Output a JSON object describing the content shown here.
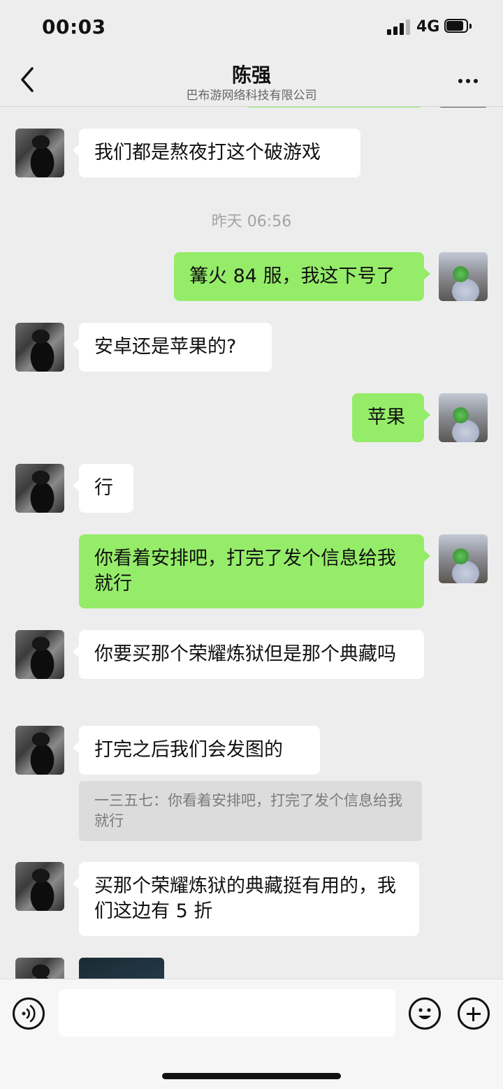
{
  "status_bar": {
    "time": "00:03",
    "network": "4G"
  },
  "header": {
    "title": "陈强",
    "subtitle": "巴布游网络科技有限公司"
  },
  "messages": [
    {
      "sender": "contact",
      "text": "我们都是熬夜打这个破游戏"
    },
    {
      "type": "timestamp",
      "text": "昨天 06:56"
    },
    {
      "sender": "me",
      "text": "篝火 84 服，我这下号了"
    },
    {
      "sender": "contact",
      "text": "安卓还是苹果的?"
    },
    {
      "sender": "me",
      "text": "苹果"
    },
    {
      "sender": "contact",
      "text": "行"
    },
    {
      "sender": "me",
      "text": "你看着安排吧，打完了发个信息给我就行"
    },
    {
      "sender": "contact",
      "text": "你要买那个荣耀炼狱但是那个典藏吗"
    },
    {
      "sender": "contact",
      "text": "打完之后我们会发图的",
      "quote": "一三五七：你看着安排吧，打完了发个信息给我就行"
    },
    {
      "sender": "contact",
      "text": "买那个荣耀炼狱的典藏挺有用的，我们这边有 5 折"
    },
    {
      "sender": "contact",
      "type": "image"
    }
  ],
  "input_bar": {
    "placeholder": ""
  },
  "colors": {
    "background": "#ededed",
    "outgoing_bubble": "#95ec69",
    "incoming_bubble": "#ffffff"
  }
}
